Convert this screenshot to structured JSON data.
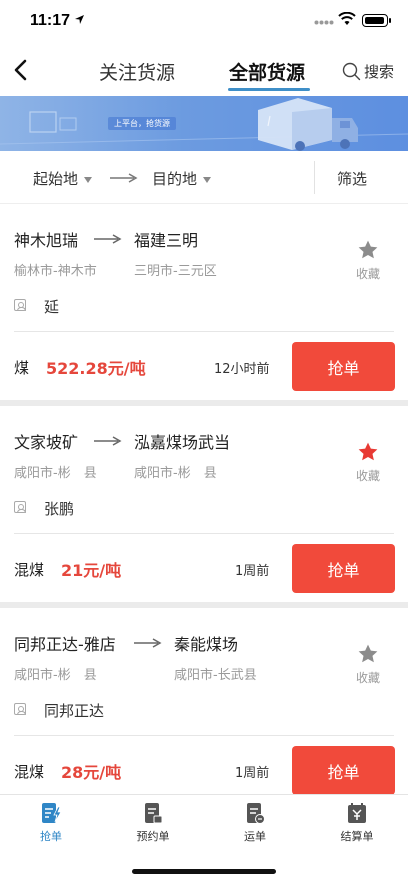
{
  "status_bar": {
    "time": "11:17"
  },
  "nav": {
    "tabs": [
      {
        "label": "关注货源",
        "active": false
      },
      {
        "label": "全部货源",
        "active": true
      }
    ],
    "search_label": "搜索"
  },
  "banner": {
    "text": "上平台，抢货源"
  },
  "filters": {
    "start_label": "起始地",
    "destination_label": "目的地",
    "screen_label": "筛选"
  },
  "cards": [
    {
      "from": "神木旭瑞",
      "to": "福建三明",
      "from_region": "榆林市-神木市",
      "to_region": "三明市-三元区",
      "contact": "延",
      "favorite_label": "收藏",
      "favorited": false,
      "cargo": "煤",
      "price": "522.28元/吨",
      "time_ago": "12小时前",
      "action_label": "抢单"
    },
    {
      "from": "文家坡矿",
      "to": "泓嘉煤场武当",
      "from_region": "咸阳市-彬　县",
      "to_region": "咸阳市-彬　县",
      "contact": "张鹏",
      "favorite_label": "收藏",
      "favorited": true,
      "cargo": "混煤",
      "price": "21元/吨",
      "time_ago": "1周前",
      "action_label": "抢单"
    },
    {
      "from": "同邦正达-雅店",
      "to": "秦能煤场",
      "from_region": "咸阳市-彬　县",
      "to_region": "咸阳市-长武县",
      "contact": "同邦正达",
      "favorite_label": "收藏",
      "favorited": false,
      "cargo": "混煤",
      "price": "28元/吨",
      "time_ago": "1周前",
      "action_label": "抢单"
    }
  ],
  "tab_bar": [
    {
      "label": "抢单",
      "icon": "grab-order-icon",
      "active": true
    },
    {
      "label": "预约单",
      "icon": "reservation-icon",
      "active": false
    },
    {
      "label": "运单",
      "icon": "waybill-icon",
      "active": false
    },
    {
      "label": "结算单",
      "icon": "settlement-icon",
      "active": false
    }
  ],
  "colors": {
    "accent": "#2f86c6",
    "price": "#e5473c",
    "button": "#f14a3b",
    "star_active": "#e83a34",
    "star_inactive": "#8c8c8c"
  }
}
